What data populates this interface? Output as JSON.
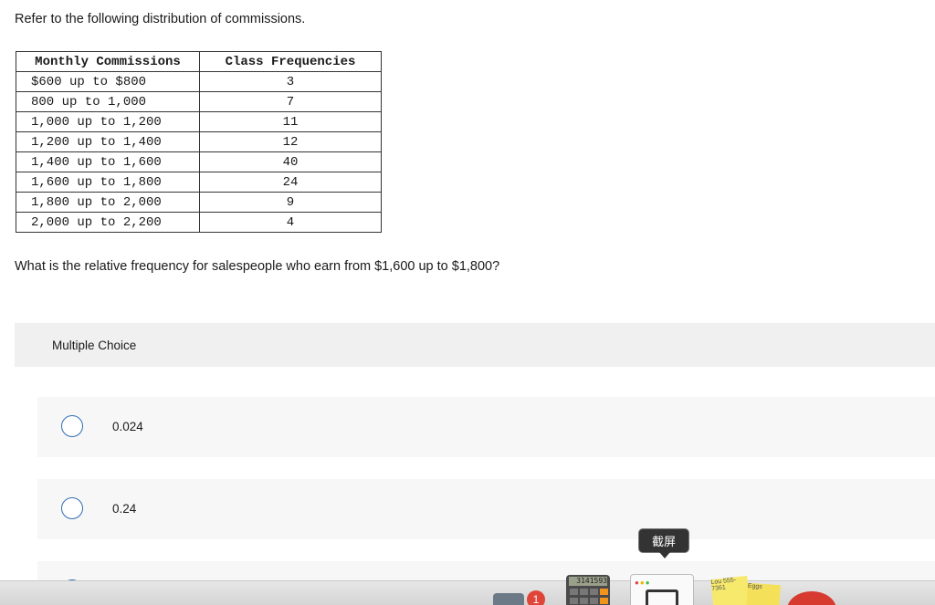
{
  "intro": "Refer to the following distribution of commissions.",
  "table": {
    "headers": [
      "Monthly Commissions",
      "Class Frequencies"
    ],
    "rows": [
      [
        "$600 up to $800",
        "3"
      ],
      [
        "800 up to 1,000",
        "7"
      ],
      [
        "1,000 up to 1,200",
        "11"
      ],
      [
        "1,200 up to 1,400",
        "12"
      ],
      [
        "1,400 up to 1,600",
        "40"
      ],
      [
        "1,600 up to 1,800",
        "24"
      ],
      [
        "1,800 up to 2,000",
        "9"
      ],
      [
        "2,000 up to 2,200",
        "4"
      ]
    ]
  },
  "question": "What is the relative frequency for salespeople who earn from $1,600 up to $1,800?",
  "multiple_choice": {
    "header": "Multiple Choice",
    "options": [
      "0.024",
      "0.24"
    ]
  },
  "overlay": {
    "tooltip": "截屏",
    "badge_count": "1",
    "calculator_display": "3141593",
    "sticky_text_1": "Lou 555-7361",
    "sticky_text_2": "Eggs"
  }
}
